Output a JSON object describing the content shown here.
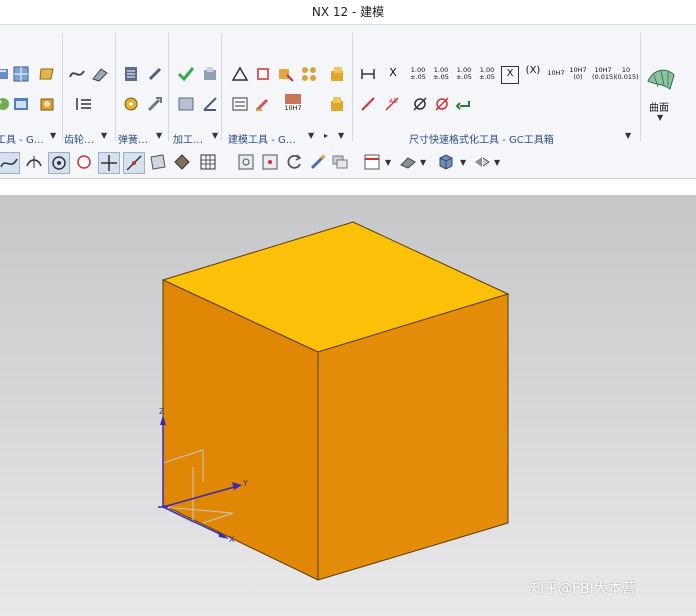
{
  "window": {
    "title": "NX 12 - 建模"
  },
  "ribbon": {
    "groups": [
      {
        "label": "工具 - G…"
      },
      {
        "label": "齿轮…"
      },
      {
        "label": "弹簧…"
      },
      {
        "label": "加工…"
      },
      {
        "label": "建模工具 - G…"
      },
      {
        "label": "尺寸快速格式化工具 - GC工具箱"
      }
    ],
    "dim_buttons": [
      {
        "top": "1.00",
        "bottom": "±.05"
      },
      {
        "top": "1.00",
        "bottom": "±.05"
      },
      {
        "top": "1.00",
        "bottom": "±.05"
      },
      {
        "top": "1.00",
        "bottom": "±.05"
      }
    ],
    "x_label": "X",
    "fit_buttons": [
      "10H7",
      "10H7",
      "10H7",
      "10"
    ],
    "fit_sub": [
      "",
      "(0)",
      "(0.015)",
      "(0.015)"
    ],
    "hole_label": "10H7",
    "surface_label": "曲面"
  },
  "viewport": {
    "triad": {
      "z": "Z",
      "y": "Y",
      "x": "X"
    },
    "watermark": "知乎@FBI大本营"
  }
}
